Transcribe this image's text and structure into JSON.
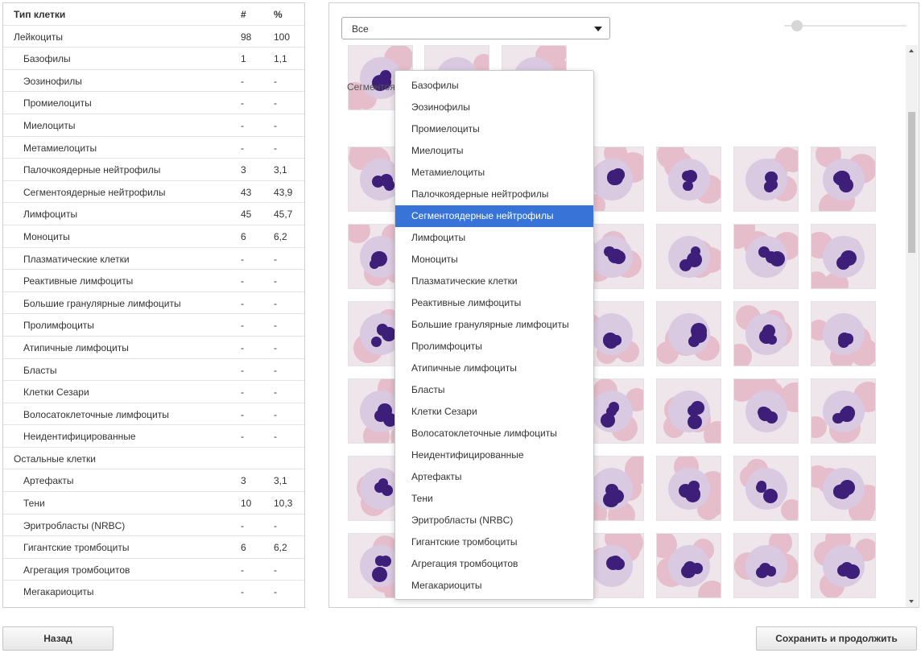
{
  "table": {
    "headers": {
      "type": "Тип клетки",
      "count": "#",
      "percent": "%"
    },
    "rows": [
      {
        "name": "Лейкоциты",
        "count": "98",
        "percent": "100",
        "level": 0
      },
      {
        "name": "Базофилы",
        "count": "1",
        "percent": "1,1",
        "level": 1
      },
      {
        "name": "Эозинофилы",
        "count": "-",
        "percent": "-",
        "level": 1
      },
      {
        "name": "Промиелоциты",
        "count": "-",
        "percent": "-",
        "level": 1
      },
      {
        "name": "Миелоциты",
        "count": "-",
        "percent": "-",
        "level": 1
      },
      {
        "name": "Метамиелоциты",
        "count": "-",
        "percent": "-",
        "level": 1
      },
      {
        "name": "Палочкоядерные нейтрофилы",
        "count": "3",
        "percent": "3,1",
        "level": 1
      },
      {
        "name": "Сегментоядерные нейтрофилы",
        "count": "43",
        "percent": "43,9",
        "level": 1
      },
      {
        "name": "Лимфоциты",
        "count": "45",
        "percent": "45,7",
        "level": 1
      },
      {
        "name": "Моноциты",
        "count": "6",
        "percent": "6,2",
        "level": 1
      },
      {
        "name": "Плазматические клетки",
        "count": "-",
        "percent": "-",
        "level": 1
      },
      {
        "name": "Реактивные лимфоциты",
        "count": "-",
        "percent": "-",
        "level": 1
      },
      {
        "name": "Большие гранулярные лимфоциты",
        "count": "-",
        "percent": "-",
        "level": 1
      },
      {
        "name": "Пролимфоциты",
        "count": "-",
        "percent": "-",
        "level": 1
      },
      {
        "name": "Атипичные лимфоциты",
        "count": "-",
        "percent": "-",
        "level": 1
      },
      {
        "name": "Бласты",
        "count": "-",
        "percent": "-",
        "level": 1
      },
      {
        "name": "Клетки Сезари",
        "count": "-",
        "percent": "-",
        "level": 1
      },
      {
        "name": "Волосатоклеточные лимфоциты",
        "count": "-",
        "percent": "-",
        "level": 1
      },
      {
        "name": "Неидентифицированные",
        "count": "-",
        "percent": "-",
        "level": 1
      },
      {
        "name": "Остальные клетки",
        "count": "",
        "percent": "",
        "level": 0
      },
      {
        "name": "Артефакты",
        "count": "3",
        "percent": "3,1",
        "level": 1
      },
      {
        "name": "Тени",
        "count": "10",
        "percent": "10,3",
        "level": 1
      },
      {
        "name": "Эритробласты (NRBC)",
        "count": "-",
        "percent": "-",
        "level": 1
      },
      {
        "name": "Гигантские тромбоциты",
        "count": "6",
        "percent": "6,2",
        "level": 1
      },
      {
        "name": "Агрегация тромбоцитов",
        "count": "-",
        "percent": "-",
        "level": 1
      },
      {
        "name": "Мегакариоциты",
        "count": "-",
        "percent": "-",
        "level": 1
      }
    ]
  },
  "filter": {
    "selected": "Все",
    "options": [
      "Базофилы",
      "Эозинофилы",
      "Промиелоциты",
      "Миелоциты",
      "Метамиелоциты",
      "Палочкоядерные нейтрофилы",
      "Сегментоядерные нейтрофилы",
      "Лимфоциты",
      "Моноциты",
      "Плазматические клетки",
      "Реактивные лимфоциты",
      "Большие гранулярные лимфоциты",
      "Пролимфоциты",
      "Атипичные лимфоциты",
      "Бласты",
      "Клетки Сезари",
      "Волосатоклеточные лимфоциты",
      "Неидентифицированные",
      "Артефакты",
      "Тени",
      "Эритробласты (NRBC)",
      "Гигантские тромбоциты",
      "Агрегация тромбоцитов",
      "Мегакариоциты"
    ],
    "highlighted_index": 6
  },
  "gallery": {
    "section_label": "Сегментоя",
    "zoom_level": 0.1
  },
  "buttons": {
    "back": "Назад",
    "save": "Сохранить и продолжить"
  },
  "colors": {
    "accent": "#3874d8",
    "nucleus": "#3d1f7a",
    "rbc": "#e6bdcb"
  },
  "icons": {
    "select_caret": "chevron-down-icon",
    "scroll_up": "arrow-up-icon",
    "scroll_down": "arrow-down-icon"
  }
}
